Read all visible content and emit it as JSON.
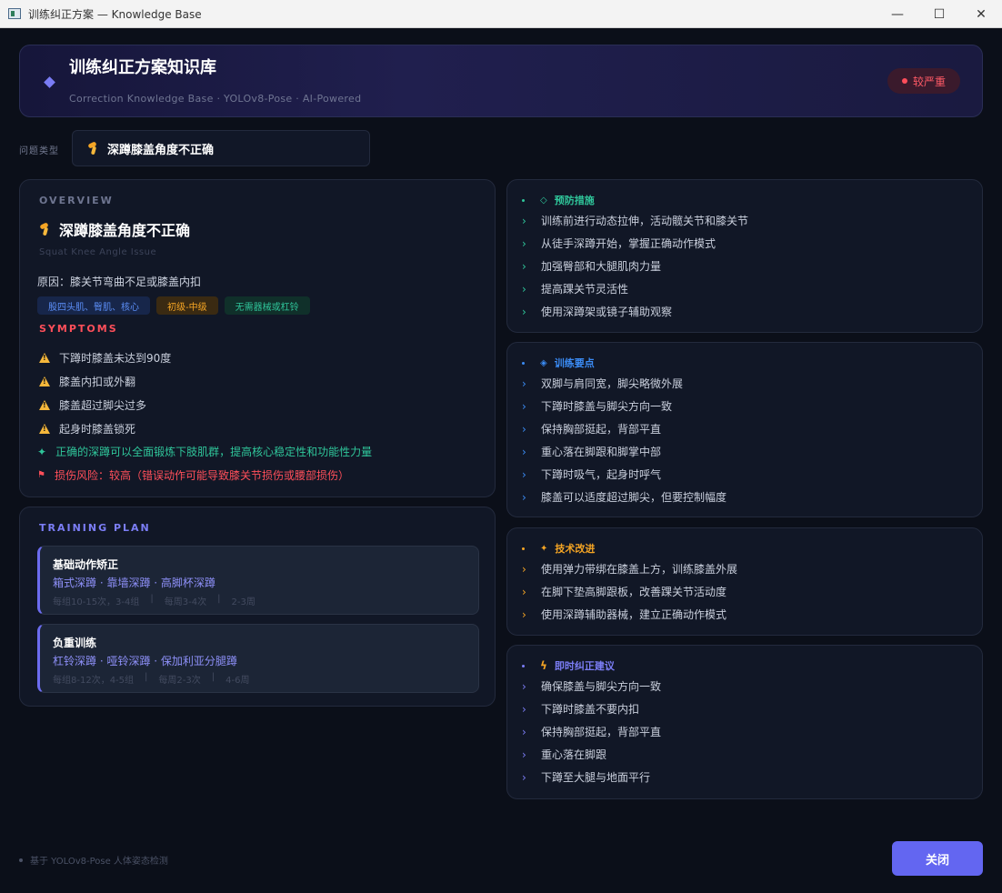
{
  "window": {
    "title": "训练纠正方案 — Knowledge Base",
    "minimize_glyph": "—",
    "maximize_glyph": "☐",
    "close_glyph": "✕"
  },
  "header": {
    "title": "训练纠正方案知识库",
    "subtitle": "Correction Knowledge Base · YOLOv8-Pose · AI-Powered",
    "severity_badge": "较严重",
    "severity_color": "#ff4d5a"
  },
  "issue_selector": {
    "label": "问题类型",
    "value": "深蹲膝盖角度不正确",
    "icon": "knee-icon"
  },
  "overview": {
    "section_label": "OVERVIEW",
    "name": "深蹲膝盖角度不正确",
    "name_en": "Squat Knee Angle Issue",
    "cause": "原因：膝关节弯曲不足或膝盖内扣",
    "tags": [
      "股四头肌、臀肌、核心",
      "初级-中级",
      "无需器械或杠铃"
    ],
    "symptoms_label": "SYMPTOMS",
    "symptoms": [
      "下蹲时膝盖未达到90度",
      "膝盖内扣或外翻",
      "膝盖超过脚尖过多",
      "起身时膝盖锁死"
    ],
    "benefit": "正确的深蹲可以全面锻炼下肢肌群，提高核心稳定性和功能性力量",
    "risk": "损伤风险：较高（错误动作可能导致膝关节损伤或腰部损伤）"
  },
  "training_plan": {
    "section_label": "TRAINING PLAN",
    "items": [
      {
        "title": "基础动作矫正",
        "exercises": "箱式深蹲 · 靠墙深蹲 · 高脚杯深蹲",
        "meta": [
          "每组10-15次，3-4组",
          "|",
          "每周3-4次",
          "|",
          "2-3周"
        ]
      },
      {
        "title": "负重训练",
        "exercises": "杠铃深蹲 · 哑铃深蹲 · 保加利亚分腿蹲",
        "meta": [
          "每组8-12次，4-5组",
          "|",
          "每周2-3次",
          "|",
          "4-6周"
        ]
      }
    ]
  },
  "prevention": {
    "title": "预防措施",
    "color": "#2fc59a",
    "items": [
      "训练前进行动态拉伸，活动髋关节和膝关节",
      "从徒手深蹲开始，掌握正确动作模式",
      "加强臀部和大腿肌肉力量",
      "提高踝关节灵活性",
      "使用深蹲架或镜子辅助观察"
    ]
  },
  "key_points": {
    "title": "训练要点",
    "color": "#3b8cf5",
    "items": [
      "双脚与肩同宽，脚尖略微外展",
      "下蹲时膝盖与脚尖方向一致",
      "保持胸部挺起，背部平直",
      "重心落在脚跟和脚掌中部",
      "下蹲时吸气，起身时呼气",
      "膝盖可以适度超过脚尖，但要控制幅度"
    ]
  },
  "technique": {
    "title": "技术改进",
    "color": "#f5a524",
    "items": [
      "使用弹力带绑在膝盖上方，训练膝盖外展",
      "在脚下垫高脚跟板，改善踝关节活动度",
      "使用深蹲辅助器械，建立正确动作模式"
    ]
  },
  "instant": {
    "title": "即时纠正建议",
    "color": "#7b7df5",
    "items": [
      "确保膝盖与脚尖方向一致",
      "下蹲时膝盖不要内扣",
      "保持胸部挺起，背部平直",
      "重心落在脚跟",
      "下蹲至大腿与地面平行"
    ]
  },
  "footer": {
    "note": "基于 YOLOv8-Pose 人体姿态检测",
    "close_label": "关闭"
  }
}
